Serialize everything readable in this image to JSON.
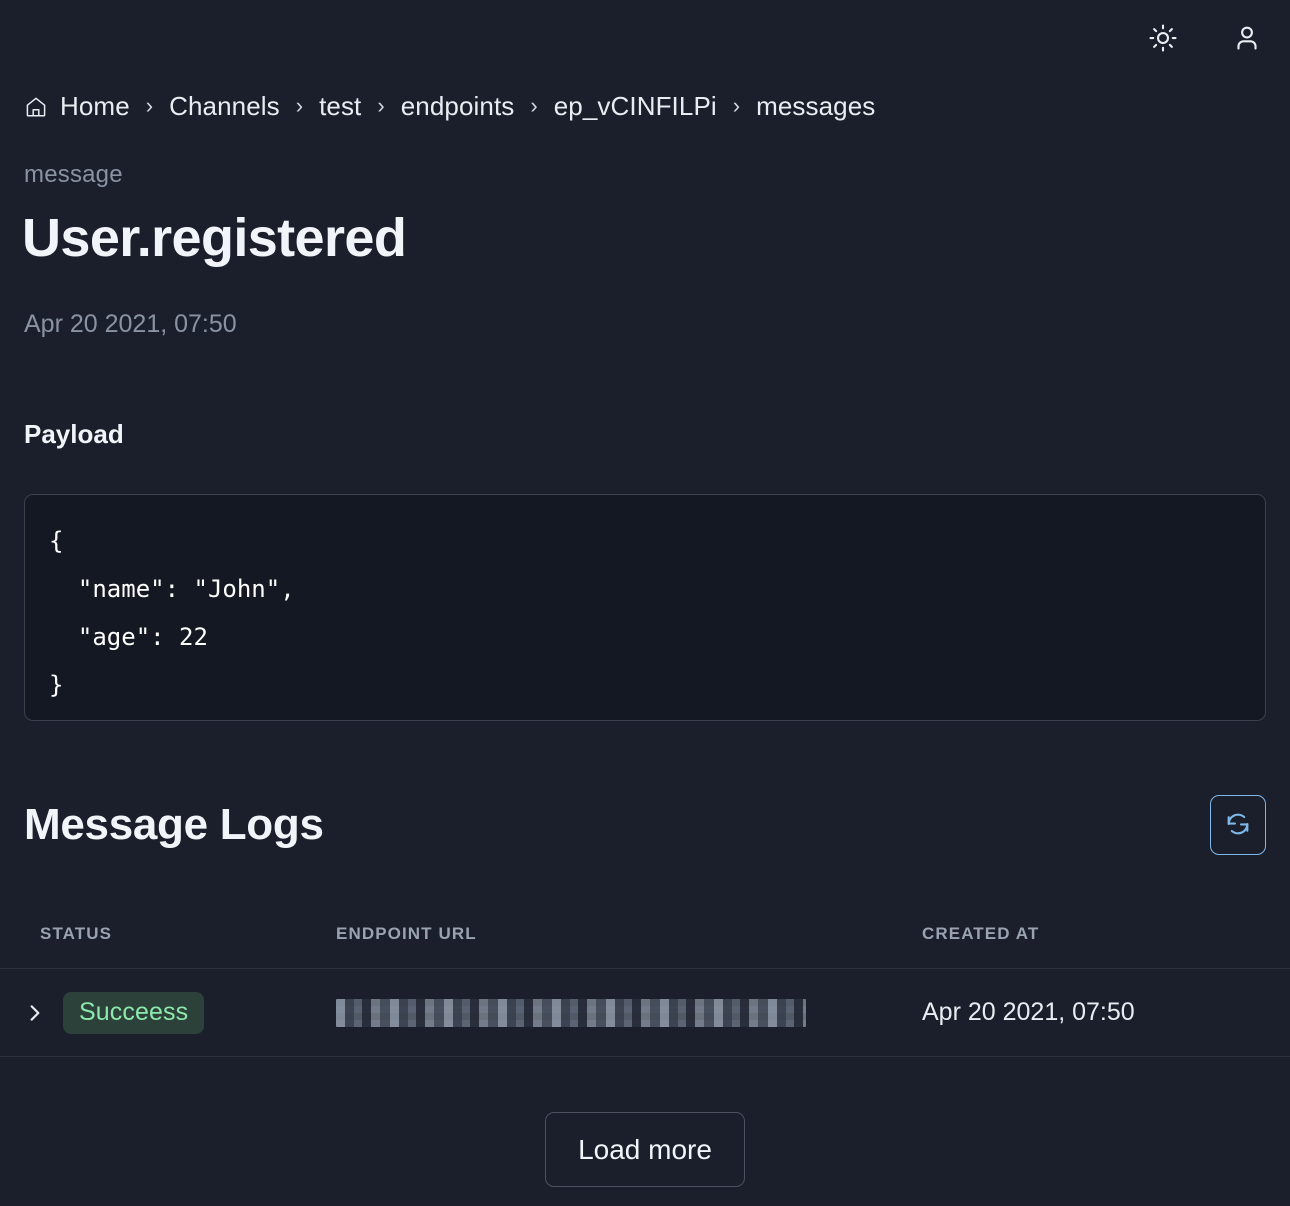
{
  "topbar": {
    "theme_toggle_label": "Toggle theme",
    "account_label": "Account"
  },
  "breadcrumb": {
    "home_icon": "home-icon",
    "separator": "›",
    "items": [
      {
        "label": "Home"
      },
      {
        "label": "Channels"
      },
      {
        "label": "test"
      },
      {
        "label": "endpoints"
      },
      {
        "label": "ep_vCINFILPi"
      },
      {
        "label": "messages"
      }
    ]
  },
  "header": {
    "eyebrow": "message",
    "title": "User.registered",
    "date": "Apr 20 2021, 07:50"
  },
  "payload": {
    "label": "Payload",
    "code": "{\n  \"name\": \"John\",\n  \"age\": 22\n}"
  },
  "logs": {
    "title": "Message Logs",
    "refresh_icon": "refresh-icon",
    "refresh_label": "Refresh",
    "columns": [
      "STATUS",
      "ENDPOINT URL",
      "CREATED AT"
    ],
    "rows": [
      {
        "expand_icon": "chevron-right-icon",
        "status": "Succeess",
        "endpoint_url": "",
        "endpoint_url_redacted": true,
        "created_at": "Apr 20 2021, 07:50"
      }
    ],
    "load_more_label": "Load more"
  },
  "colors": {
    "page_background": "#1a1f2b",
    "panel_background": "#141822",
    "border": "#39404e",
    "text_primary": "#e9edf2",
    "text_muted": "#8a93a3",
    "accent_blue": "#7fb8e8",
    "badge_background": "#2c4139",
    "badge_text": "#8de8ab"
  }
}
